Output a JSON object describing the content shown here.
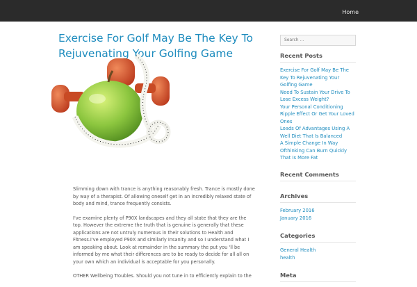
{
  "header": {
    "nav": {
      "home": "Home"
    }
  },
  "post": {
    "title": "Exercise For Golf May Be The Key To Rejuvenating Your Golfing Game",
    "paragraphs": [
      "Slimming down with trance is anything reasonably fresh. Trance is mostly done by way of a therapist. Of allowing oneself get in an incredibly relaxed state of body and mind, trance frequently consists.",
      "I've examine plenty of P90X landscapes and they all state that they are the top. However the extreme the truth that is genuine is generally that these applications are not untruly numerous in their solutions to Health and Fitness.I've employed P90X and similarly Insanity and so I understand what I am speaking about. Look at remainder in the summary the put you 'll be informed by me what their differences are to be ready to decide for all all on your own which an individual is acceptable for you personally.",
      "OTHER Wellbeing Troubles. Should you not tune in to efficiently explain to the"
    ]
  },
  "sidebar": {
    "search_placeholder": "Search ...",
    "recent_posts": {
      "title": "Recent Posts",
      "items": [
        "Exercise For Golf May Be The Key To Rejuvenating Your Golfing Game",
        "Need To Sustain Your Drive To Lose Excess Weight?",
        "Your Personal Conditioning Ripple Effect Or Get Your Loved Ones",
        "Loads Of Advantages Using A Well Diet That Is Balanced",
        "A Simple Change In Way Ofthinking Can Burn Quickly That Is More Fat"
      ]
    },
    "recent_comments": {
      "title": "Recent Comments"
    },
    "archives": {
      "title": "Archives",
      "items": [
        "February 2016",
        "January 2016"
      ]
    },
    "categories": {
      "title": "Categories",
      "items": [
        "General Health",
        "health"
      ]
    },
    "meta": {
      "title": "Meta"
    }
  }
}
